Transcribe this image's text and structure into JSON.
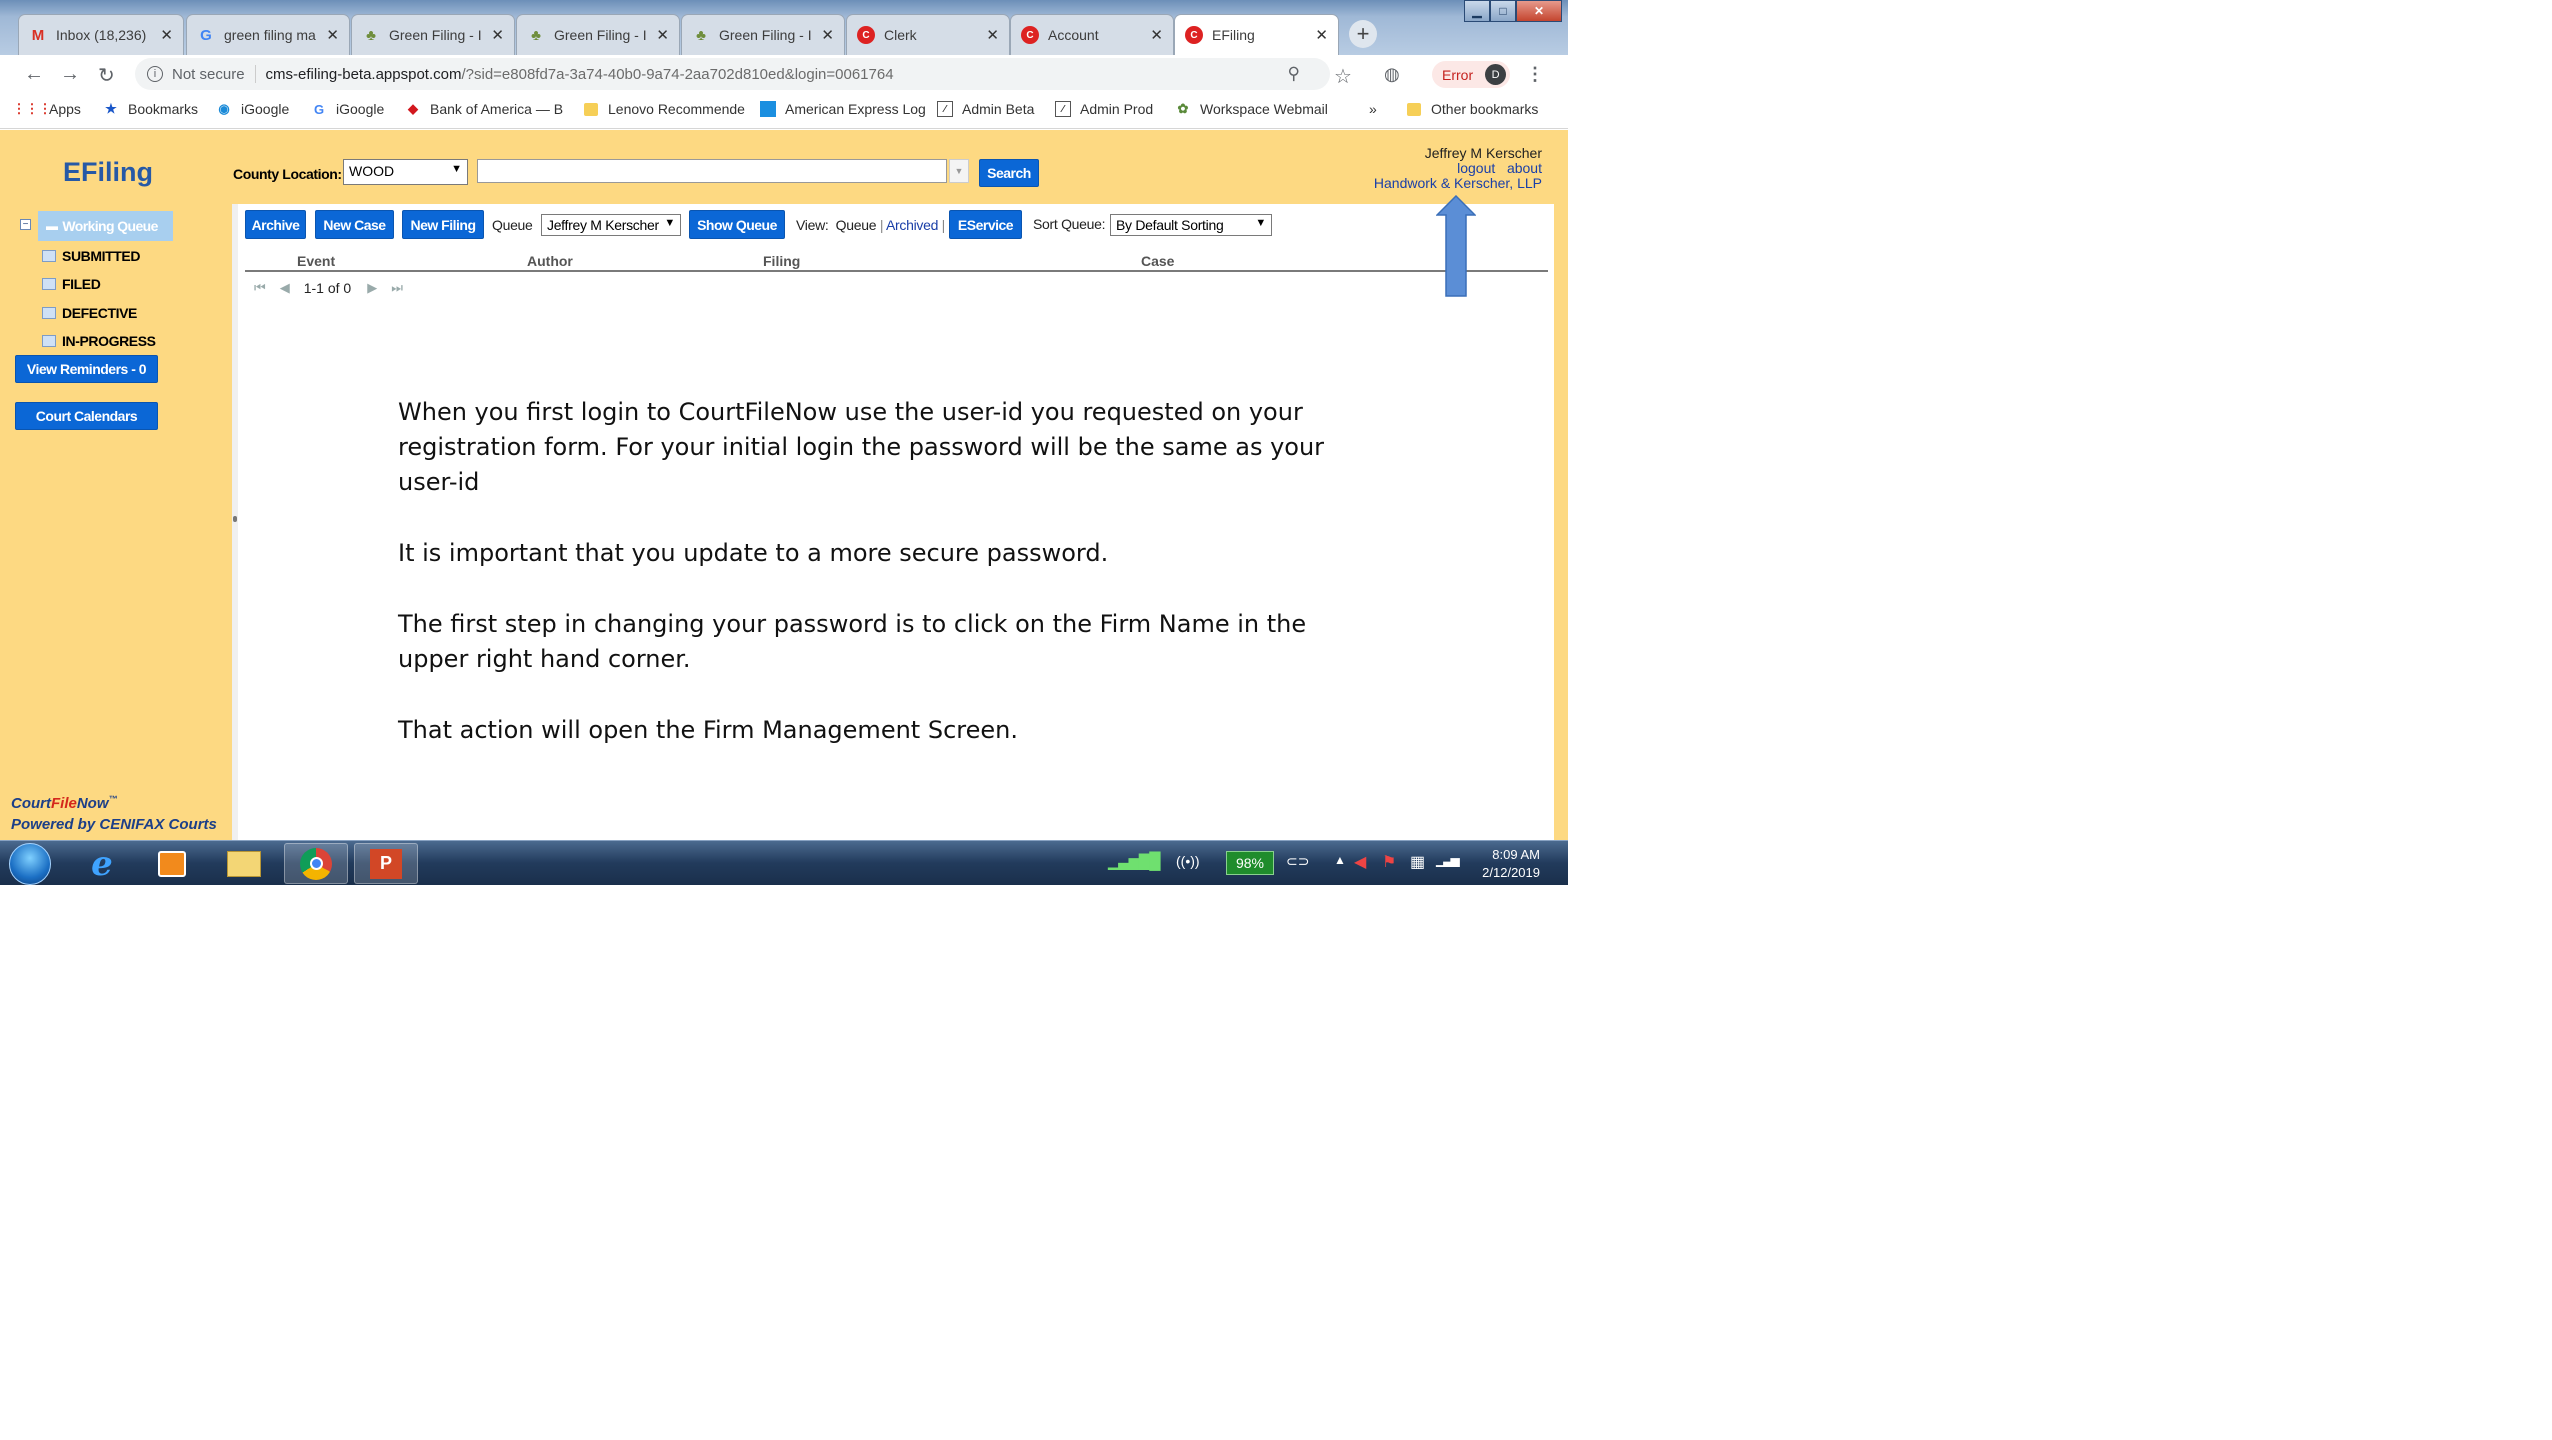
{
  "browser": {
    "tabs": [
      {
        "label": "Inbox (18,236)",
        "icon": "gmail-icon",
        "active": false
      },
      {
        "label": "green filing ma",
        "icon": "google-icon",
        "active": false
      },
      {
        "label": "Green Filing - I",
        "icon": "leaf-icon",
        "active": false
      },
      {
        "label": "Green Filing - I",
        "icon": "leaf-icon",
        "active": false
      },
      {
        "label": "Green Filing - I",
        "icon": "leaf-icon",
        "active": false
      },
      {
        "label": "Clerk",
        "icon": "cfn-icon",
        "active": false
      },
      {
        "label": "Account",
        "icon": "cfn-icon",
        "active": false
      },
      {
        "label": "EFiling",
        "icon": "cfn-icon",
        "active": true
      }
    ],
    "url_security": "Not secure",
    "url_host": "cms-efiling-beta.appspot.com",
    "url_path": "/?sid=e808fd7a-3a74-40b0-9a74-2aa702d810ed&login=0061764",
    "error_label": "Error",
    "profile_initial": "D",
    "bookmarks": [
      {
        "label": "Apps"
      },
      {
        "label": "Bookmarks"
      },
      {
        "label": "iGoogle"
      },
      {
        "label": "iGoogle"
      },
      {
        "label": "Bank of America — B"
      },
      {
        "label": "Lenovo Recommende"
      },
      {
        "label": "American Express Log"
      },
      {
        "label": "Admin Beta"
      },
      {
        "label": "Admin Prod"
      },
      {
        "label": "Workspace Webmail"
      }
    ],
    "bookmarks_more": "»",
    "other_bookmarks": "Other bookmarks"
  },
  "header": {
    "logo": "EFiling",
    "county_label": "County Location:",
    "county_value": "WOOD",
    "search_label": "Search",
    "user_name": "Jeffrey M Kerscher",
    "logout": "logout",
    "about": "about",
    "firm_name": "Handwork & Kerscher, LLP"
  },
  "sidebar": {
    "working_queue": "Working Queue",
    "items": [
      "SUBMITTED",
      "FILED",
      "DEFECTIVE",
      "IN-PROGRESS"
    ],
    "reminders_button": "View Reminders - 0",
    "calendars_button": "Court Calendars",
    "brand_a": "Court",
    "brand_b": "File",
    "brand_c": "Now",
    "brand_tm": "™",
    "powered_by": "Powered by CENIFAX Courts"
  },
  "toolbar": {
    "archive": "Archive",
    "new_case": "New Case",
    "new_filing": "New Filing",
    "queue_label": "Queue",
    "queue_value": "Jeffrey M Kerscher",
    "show_queue": "Show Queue",
    "view_label": "View:",
    "view_queue": "Queue",
    "view_sep": "|",
    "view_archived": "Archived",
    "view_sep2": "|",
    "eservice": "EService",
    "sort_label": "Sort Queue:",
    "sort_value": "By Default Sorting"
  },
  "table": {
    "columns": [
      "Event",
      "Author",
      "Filing",
      "Case"
    ],
    "pager_text": "1-1 of 0"
  },
  "instructions": [
    "When you first login to CourtFileNow use the user-id you requested on your registration form. For your initial login the password will be the same as your user-id",
    "It is important that you update to a more secure password.",
    "The first step in changing your password is to click on the Firm Name in the upper right hand corner.",
    "That action will open the Firm Management Screen."
  ],
  "taskbar": {
    "battery": "98%",
    "time": "8:09 AM",
    "date": "2/12/2019"
  },
  "colors": {
    "page_bg": "#fdd982",
    "button_blue": "#0b67d6",
    "brand_blue": "#2659a6",
    "arrow_blue": "#5b8ed6"
  }
}
